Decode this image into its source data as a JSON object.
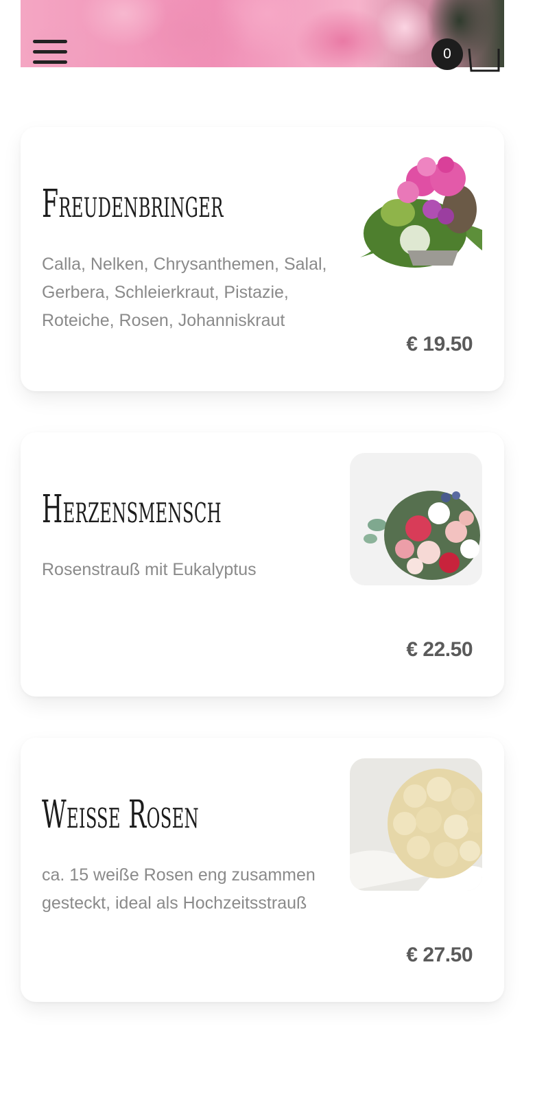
{
  "header": {
    "cart_count": "0"
  },
  "products": [
    {
      "title": "Freudenbringer",
      "description": "Calla, Nelken, Chrysanthemen, Salal, Gerbera, Schleierkraut, Pistazie, Roteiche, Rosen, Johanniskraut",
      "price": "€ 19.50"
    },
    {
      "title": "Herzensmensch",
      "description": "Rosenstrauß mit Eukalyptus",
      "price": "€ 22.50"
    },
    {
      "title": "Weiße Rosen",
      "description": "ca. 15 weiße Rosen eng zusammen gesteckt, ideal als Hochzeitsstrauß",
      "price": "€ 27.50"
    }
  ],
  "colors": {
    "text_dark": "#1c1c1c",
    "text_muted": "#8a8a8a",
    "price": "#5a5a5a",
    "badge": "#1d1d1d"
  }
}
